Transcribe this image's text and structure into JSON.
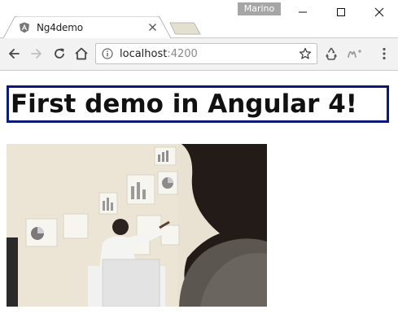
{
  "window": {
    "profile_name": "Marino"
  },
  "tab": {
    "title": "Ng4demo",
    "favicon": "angular-icon"
  },
  "toolbar": {
    "back_icon": "back-arrow-icon",
    "forward_icon": "forward-arrow-icon",
    "reload_icon": "reload-icon",
    "home_icon": "home-icon",
    "url_host": "localhost",
    "url_port": ":4200",
    "security_icon": "info-icon",
    "bookmark_icon": "star-icon",
    "extensions": [
      "recycle-extension-icon",
      "movistar-extension-icon"
    ],
    "menu_icon": "kebab-menu-icon"
  },
  "page": {
    "heading": "First demo in Angular 4!",
    "heading_border_color": "#0b1a7a",
    "image": "office-presentation-photo"
  }
}
